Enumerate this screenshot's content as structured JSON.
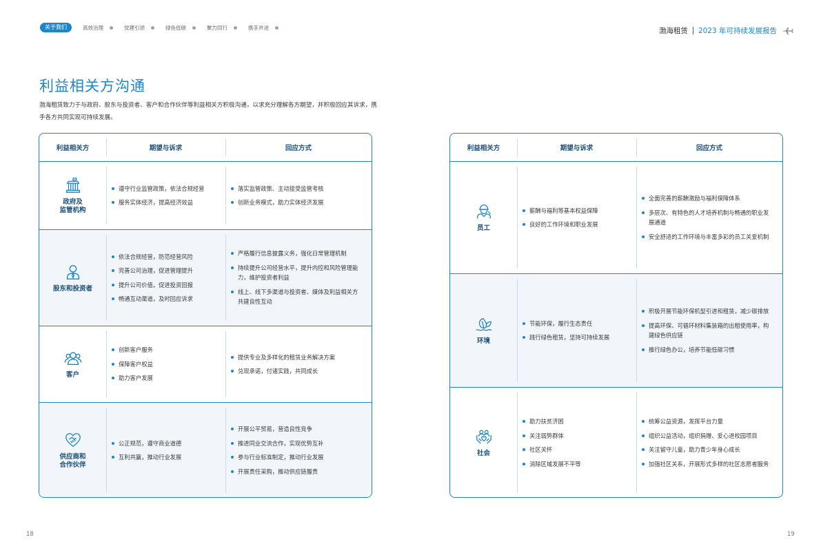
{
  "nav": {
    "active": "关于我们",
    "items": [
      "高效治理",
      "党建引领",
      "绿色低碳",
      "聚力同行",
      "携手并进"
    ]
  },
  "brand": {
    "name": "渤海租赁",
    "report": "2023 年可持续发展报告"
  },
  "title": "利益相关方沟通",
  "intro": "渤海租赁致力于与政府、股东与投资者、客户和合作伙伴等利益相关方积极沟通，以求充分理解各方期望，并积极回应其诉求，携手各方共同实现可持续发展。",
  "headers": {
    "col1": "利益相关方",
    "col2": "期望与诉求",
    "col3": "回应方式"
  },
  "left_rows": [
    {
      "label": "政府及\n监管机构",
      "icon": "government-building-icon",
      "expectations": [
        "遵守行业监管政策，依法合规经营",
        "服务实体经济，提高经济效益"
      ],
      "responses": [
        "落实监管政策、主动接受监管考核",
        "创新业务模式，助力实体经济发展"
      ]
    },
    {
      "label": "股东和投资者",
      "icon": "person-icon",
      "expectations": [
        "依法合规经营，防范经营风险",
        "完善公司治理，促进管理提升",
        "提升公司价值，促进投资回报",
        "畅通互动渠道，及时回应诉求"
      ],
      "responses": [
        "严格履行信息披露义务，强化日常管理机制",
        "持续提升公司经营水平，提升内控和风险管理能力，维护投资者利益",
        "线上、线下多渠道与投资者、媒体及利益相关方共建良性互动"
      ]
    },
    {
      "label": "客户",
      "icon": "customers-icon",
      "expectations": [
        "创新客户服务",
        "保障客户权益",
        "助力客户发展"
      ],
      "responses": [
        "提供专业及多样化的租赁业务解决方案",
        "兑现承诺，付诸实践，共同成长"
      ]
    },
    {
      "label": "供应商和\n合作伙伴",
      "icon": "handshake-icon",
      "expectations": [
        "公正规范，遵守商业道德",
        "互利共赢，推动行业发展"
      ],
      "responses": [
        "开展公平贸易，营造良性竞争",
        "推进同业交流合作，实现优势互补",
        "参与行业标准制定，推动行业发展",
        "开展责任采购，推动供应链履责"
      ]
    }
  ],
  "right_rows": [
    {
      "label": "员工",
      "icon": "worker-helmet-icon",
      "expectations": [
        "薪酬与福利等基本权益保障",
        "良好的工作环境和职业发展"
      ],
      "responses": [
        "全面完善的薪酬激励与福利保障体系",
        "多层次、有特色的人才培养机制与畅通的职业发展通道",
        "安全舒适的工作环境与丰富多彩的员工关爱机制"
      ]
    },
    {
      "label": "环境",
      "icon": "environment-leaf-icon",
      "expectations": [
        "节能环保，履行生态责任",
        "践行绿色租赁，坚持可持续发展"
      ],
      "responses": [
        "积极开展节能环保机型引进和租赁，减少碳排放",
        "提高环保、可循环材料集装箱的出租使用率，构建绿色供应链",
        "推行绿色办公，培养节能低碳习惯"
      ]
    },
    {
      "label": "社会",
      "icon": "community-hands-icon",
      "expectations": [
        "助力扶贫济困",
        "关注弱势群体",
        "社区关怀",
        "消除区域发展不平等"
      ],
      "responses": [
        "统筹公益资源，发挥平台力量",
        "组织公益活动，组织捐赠、爱心进校园项目",
        "关注留守儿童，助力青少年身心成长",
        "加强社区关系，开展形式多样的社区志愿者服务"
      ]
    }
  ],
  "page_numbers": {
    "left": "18",
    "right": "19"
  },
  "colors": {
    "accent": "#1d85c8",
    "shade": "#f2f6fa"
  }
}
